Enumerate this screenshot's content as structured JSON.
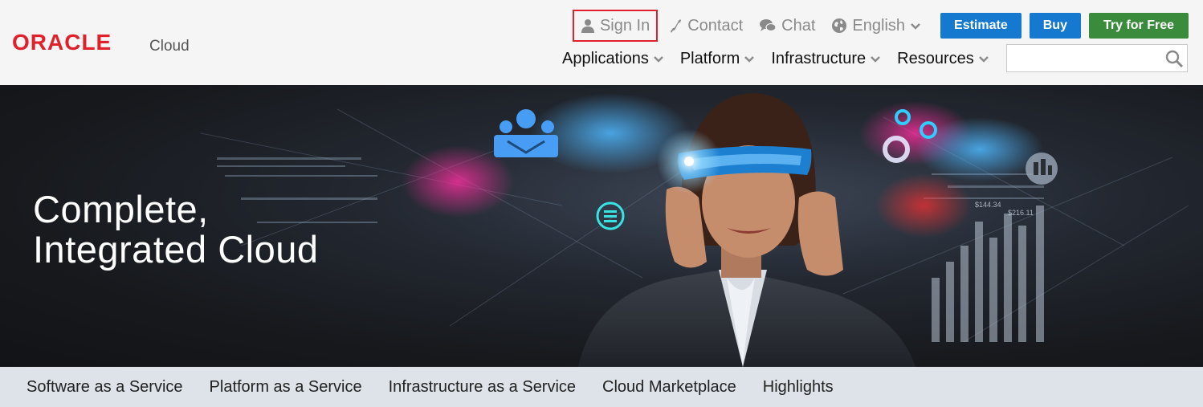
{
  "brand": {
    "logo_text": "ORACLE",
    "product": "Cloud",
    "logo_color": "#e0202a"
  },
  "utility_links": {
    "sign_in": "Sign In",
    "contact": "Contact",
    "chat": "Chat",
    "language": "English"
  },
  "buttons": {
    "estimate": "Estimate",
    "buy": "Buy",
    "try_free": "Try for Free"
  },
  "colors": {
    "primary_button": "#1479cf",
    "free_button": "#3a8c3c",
    "highlight_border": "#e0202a"
  },
  "main_nav": {
    "items": [
      "Applications",
      "Platform",
      "Infrastructure",
      "Resources"
    ]
  },
  "search": {
    "value": "",
    "placeholder": ""
  },
  "hero": {
    "title_line1": "Complete,",
    "title_line2": "Integrated Cloud",
    "chart_label_1": "$216.11",
    "chart_label_2": "$144.34"
  },
  "sub_nav": {
    "items": [
      "Software as a Service",
      "Platform as a Service",
      "Infrastructure as a Service",
      "Cloud Marketplace",
      "Highlights"
    ]
  }
}
